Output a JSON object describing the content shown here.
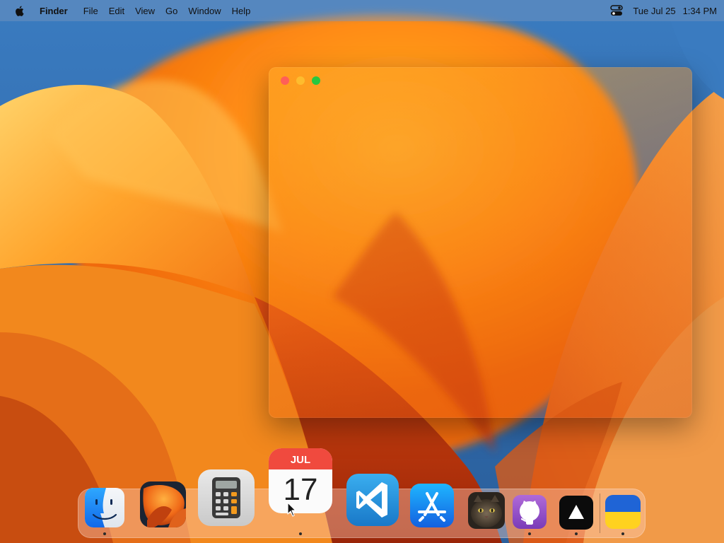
{
  "menubar": {
    "app_name": "Finder",
    "menus": [
      "File",
      "Edit",
      "View",
      "Go",
      "Window",
      "Help"
    ],
    "date": "Tue Jul 25",
    "time": "1:34 PM"
  },
  "dock": {
    "calendar": {
      "month": "JUL",
      "day": "17"
    },
    "items": [
      "finder-icon",
      "wallpaper-app-icon",
      "calculator-icon",
      "calendar-icon",
      "vscode-icon",
      "app-store-icon",
      "cat-photo-icon",
      "github-icon",
      "vercel-icon",
      "ukraine-flag-icon"
    ]
  },
  "colors": {
    "close": "#ff5f57",
    "minimize": "#febc2e",
    "zoom": "#28c840"
  }
}
